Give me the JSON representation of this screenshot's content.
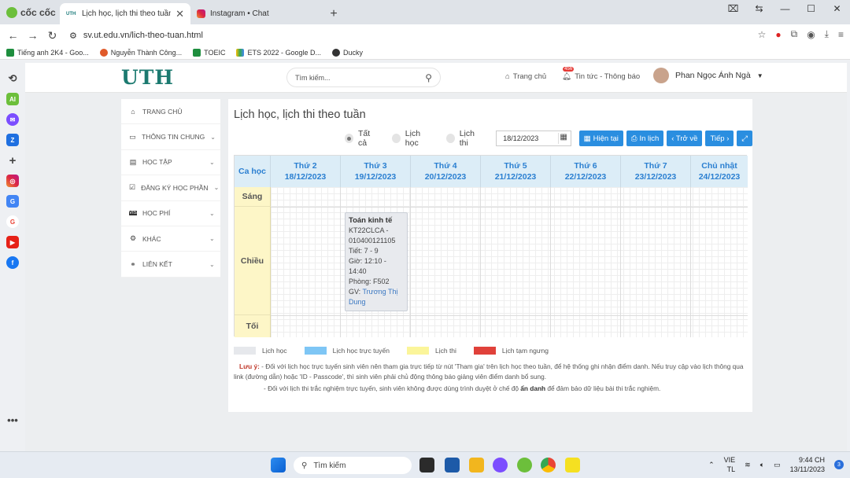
{
  "browser": {
    "brand": "cốc cốc",
    "tabs": [
      {
        "label": "Lịch học, lịch thi theo tuần",
        "favicon": "UTH"
      },
      {
        "label": "Instagram • Chat"
      }
    ],
    "url": "sv.ut.edu.vn/lich-theo-tuan.html",
    "bookmarks": [
      "Tiếng anh 2K4 - Goo...",
      "Nguyễn Thành Công...",
      "TOEIC",
      "ETS 2022 - Google D...",
      "Ducky"
    ]
  },
  "site": {
    "logo": "UTH",
    "search_placeholder": "Tìm kiếm...",
    "nav_home": "Trang chủ",
    "nav_news": "Tin tức - Thông báo",
    "news_badge": "456",
    "user_name": "Phan Ngọc Ánh Ngà"
  },
  "menu": {
    "items": [
      {
        "label": "TRANG CHỦ",
        "icon": "home-icon"
      },
      {
        "label": "THÔNG TIN CHUNG",
        "icon": "monitor-icon"
      },
      {
        "label": "HỌC TẬP",
        "icon": "book-icon"
      },
      {
        "label": "ĐĂNG KÝ HỌC PHẦN",
        "icon": "checkbox-icon"
      },
      {
        "label": "HỌC PHÍ",
        "icon": "visa-icon"
      },
      {
        "label": "KHÁC",
        "icon": "gear-icon"
      },
      {
        "label": "LIÊN KẾT",
        "icon": "link-icon"
      }
    ]
  },
  "schedule": {
    "title": "Lịch học, lịch thi theo tuần",
    "filter_all": "Tất cả",
    "filter_study": "Lịch học",
    "filter_exam": "Lịch thi",
    "selected_filter": "Tất cả",
    "date": "18/12/2023",
    "btn_current": "Hiện tại",
    "btn_print": "In lịch",
    "btn_back": "‹ Trở về",
    "btn_next": "Tiếp ›",
    "col_shift": "Ca học",
    "days": [
      {
        "name": "Thứ 2",
        "date": "18/12/2023"
      },
      {
        "name": "Thứ 3",
        "date": "19/12/2023"
      },
      {
        "name": "Thứ 4",
        "date": "20/12/2023"
      },
      {
        "name": "Thứ 5",
        "date": "21/12/2023"
      },
      {
        "name": "Thứ 6",
        "date": "22/12/2023"
      },
      {
        "name": "Thứ 7",
        "date": "23/12/2023"
      },
      {
        "name": "Chủ nhật",
        "date": "24/12/2023"
      }
    ],
    "shifts": [
      "Sáng",
      "Chiều",
      "Tối"
    ],
    "event": {
      "title": "Toán kinh tế",
      "class": "KT22CLCA -",
      "code": "010400121105",
      "period": "Tiết: 7 - 9",
      "time1": "Giờ: 12:10 -",
      "time2": "14:40",
      "room": "Phòng: F502",
      "teacher_label": "GV: ",
      "teacher": "Trương Thị Dung"
    },
    "legend": [
      {
        "label": "Lịch học",
        "color": "#e6e8ec"
      },
      {
        "label": "Lịch học trực tuyến",
        "color": "#7ec6f5"
      },
      {
        "label": "Lịch thi",
        "color": "#fbf59a"
      },
      {
        "label": "Lịch tạm ngưng",
        "color": "#e0413a"
      }
    ],
    "note_label": "Lưu ý:",
    "note_1": " - Đối với lịch học trực tuyến sinh viên nên tham gia trực tiếp từ nút 'Tham gia' trên lịch học theo tuần, để hệ thống ghi nhận điểm danh. Nếu truy cập vào lịch thông qua link (đường dẫn) hoặc 'ID - Passcode', thì sinh viên phải chủ động thông báo giảng viên điểm danh bổ sung.",
    "note_2a": "- Đối với lịch thi trắc nghiệm trực tuyến, sinh viên không được dùng trình duyệt ở chế độ ",
    "note_2b": "ẩn danh",
    "note_2c": " để đảm bảo dữ liệu bài thi trắc nghiệm."
  },
  "taskbar": {
    "search": "Tìm kiếm",
    "lang1": "VIE",
    "lang2": "TL",
    "time": "9:44 CH",
    "date": "13/11/2023",
    "notifications": "3"
  }
}
